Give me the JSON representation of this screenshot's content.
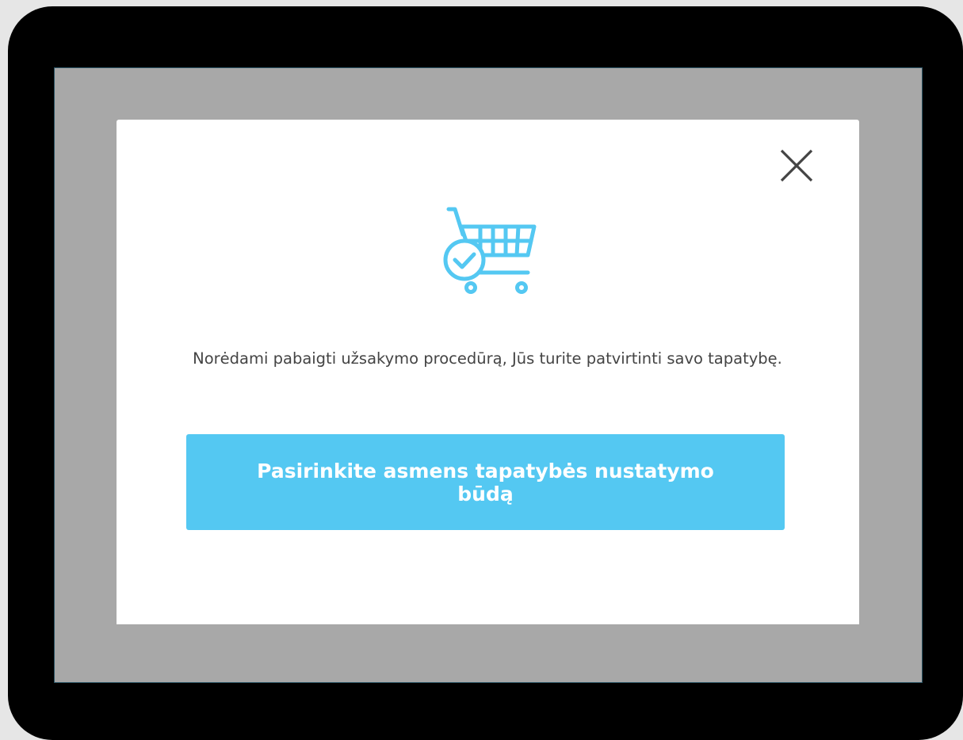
{
  "modal": {
    "message": "Norėdami pabaigti užsakymo procedūrą, Jūs turite patvirtinti savo tapatybę.",
    "primary_button_label": "Pasirinkite asmens tapatybės nustatymo būdą",
    "close_icon": "close-icon",
    "illustration_icon": "cart-check-icon"
  },
  "colors": {
    "accent": "#54c8f2",
    "overlay": "#a8a8a8",
    "frame": "#000000",
    "text": "#444444"
  }
}
